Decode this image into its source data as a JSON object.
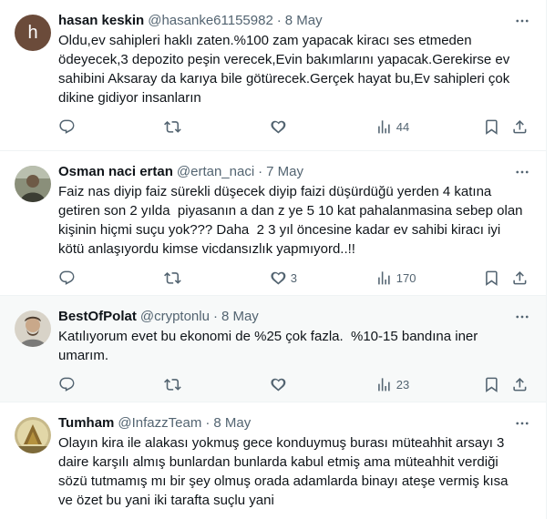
{
  "tweets": [
    {
      "name": "hasan keskin",
      "handle": "@hasanke61155982",
      "date": "8 May",
      "avatar_letter": "h",
      "text": "Oldu,ev sahipleri haklı zaten.%100 zam yapacak kiracı ses etmeden\nödeyecek,3 depozito peşin verecek,Evin bakımlarını yapacak.Gerekirse ev\nsahibini Aksaray da karıya bile götürecek.Gerçek hayat bu,Ev sahipleri çok\ndikine gidiyor insanların",
      "likes": "",
      "views": "44"
    },
    {
      "name": "Osman naci ertan",
      "handle": "@ertan_naci",
      "date": "7 May",
      "text": "Faiz nas diyip faiz sürekli düşecek diyip faizi düşürdüğü yerden 4 katına\ngetiren son 2 yılda  piyasanın a dan z ye 5 10 kat pahalanmasina sebep olan\nkişinin hiçmi suçu yok??? Daha  2 3 yıl öncesine kadar ev sahibi kiracı iyi\nkötü anlaşıyordu kimse vicdansızlık yapmıyord..!!",
      "likes": "3",
      "views": "170"
    },
    {
      "name": "BestOfPolat",
      "handle": "@cryptonlu",
      "date": "8 May",
      "text": "Katılıyorum evet bu ekonomi de %25 çok fazla.  %10-15 bandına iner\numarım.",
      "likes": "",
      "views": "23"
    },
    {
      "name": "Tumham",
      "handle": "@InfazzTeam",
      "date": "8 May",
      "text": "Olayın kira ile alakası yokmuş gece konduymuş burası müteahhit arsayı 3\ndaire karşılı almış bunlardan bunlarda kabul etmiş ama müteahhit verdiği\nsözü tutmamış mı bir şey olmuş orada adamlarda binayı ateşe vermiş kısa\nve özet bu yani iki tarafta suçlu yani"
    }
  ],
  "icons": [
    "reply-icon",
    "retweet-icon",
    "like-icon",
    "views-icon",
    "bookmark-icon",
    "share-icon",
    "more-icon"
  ]
}
